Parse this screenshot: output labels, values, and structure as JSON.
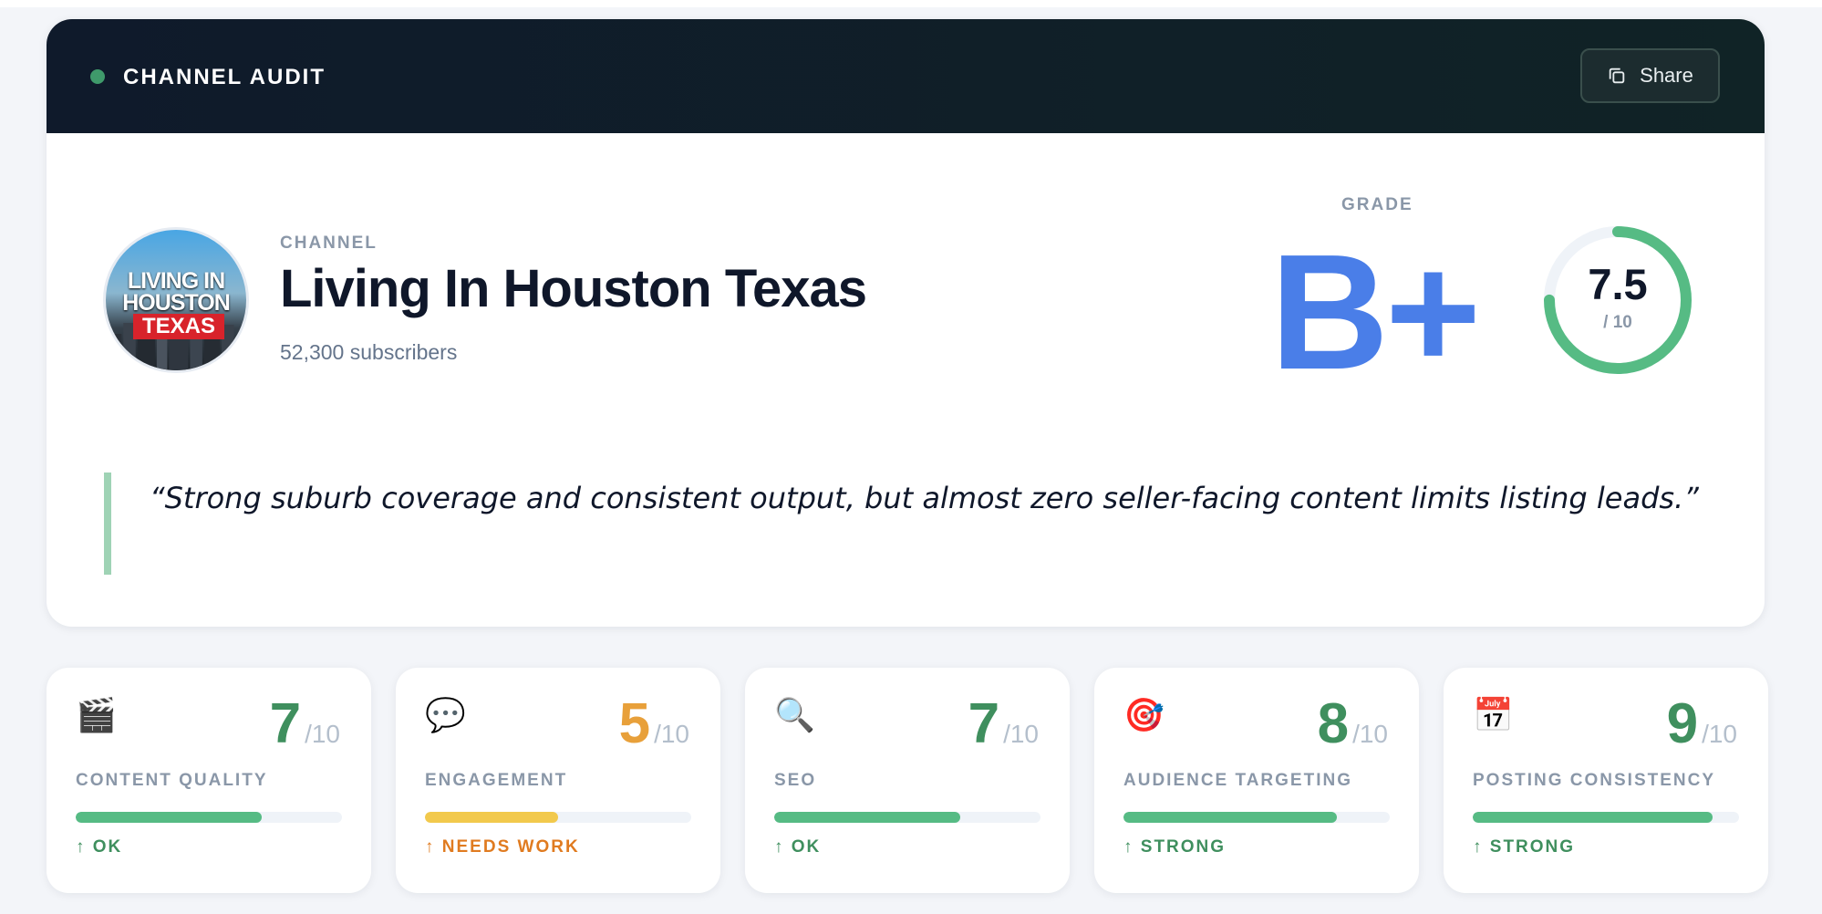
{
  "header": {
    "title": "CHANNEL AUDIT",
    "share_label": "Share"
  },
  "channel": {
    "label": "CHANNEL",
    "name": "Living In Houston Texas",
    "subscribers": "52,300 subscribers",
    "avatar_text_line1": "LIVING IN",
    "avatar_text_line2": "HOUSTON",
    "avatar_text_line3": "TEXAS"
  },
  "grade": {
    "label": "GRADE",
    "letter": "B+",
    "score": "7.5",
    "score_max": "/ 10",
    "score_fraction": 0.75
  },
  "quote": "“Strong suburb coverage and consistent output, but almost zero seller-facing content limits listing leads.”",
  "metrics": [
    {
      "icon": "🎬",
      "icon_name": "clapper-icon",
      "value": "7",
      "max": "/10",
      "label": "CONTENT QUALITY",
      "status": "↑ OK",
      "fill": 0.7,
      "color": "#3f8f5e",
      "bar_color": "#56bb84"
    },
    {
      "icon": "💬",
      "icon_name": "speech-bubble-icon",
      "value": "5",
      "max": "/10",
      "label": "ENGAGEMENT",
      "status": "↑ NEEDS WORK",
      "fill": 0.5,
      "color": "#e8a03a",
      "bar_color": "#f2c94c",
      "status_color": "#e07b20"
    },
    {
      "icon": "🔍",
      "icon_name": "magnifier-icon",
      "value": "7",
      "max": "/10",
      "label": "SEO",
      "status": "↑ OK",
      "fill": 0.7,
      "color": "#3f8f5e",
      "bar_color": "#56bb84"
    },
    {
      "icon": "🎯",
      "icon_name": "target-icon",
      "value": "8",
      "max": "/10",
      "label": "AUDIENCE TARGETING",
      "status": "↑ STRONG",
      "fill": 0.8,
      "color": "#3f8f5e",
      "bar_color": "#56bb84"
    },
    {
      "icon": "📅",
      "icon_name": "calendar-icon",
      "value": "9",
      "max": "/10",
      "label": "POSTING CONSISTENCY",
      "status": "↑ STRONG",
      "fill": 0.9,
      "color": "#3f8f5e",
      "bar_color": "#56bb84"
    }
  ],
  "colors": {
    "accent_blue": "#4a7ee8",
    "ring_green": "#56bb84",
    "status_green": "#3f8f5e"
  }
}
